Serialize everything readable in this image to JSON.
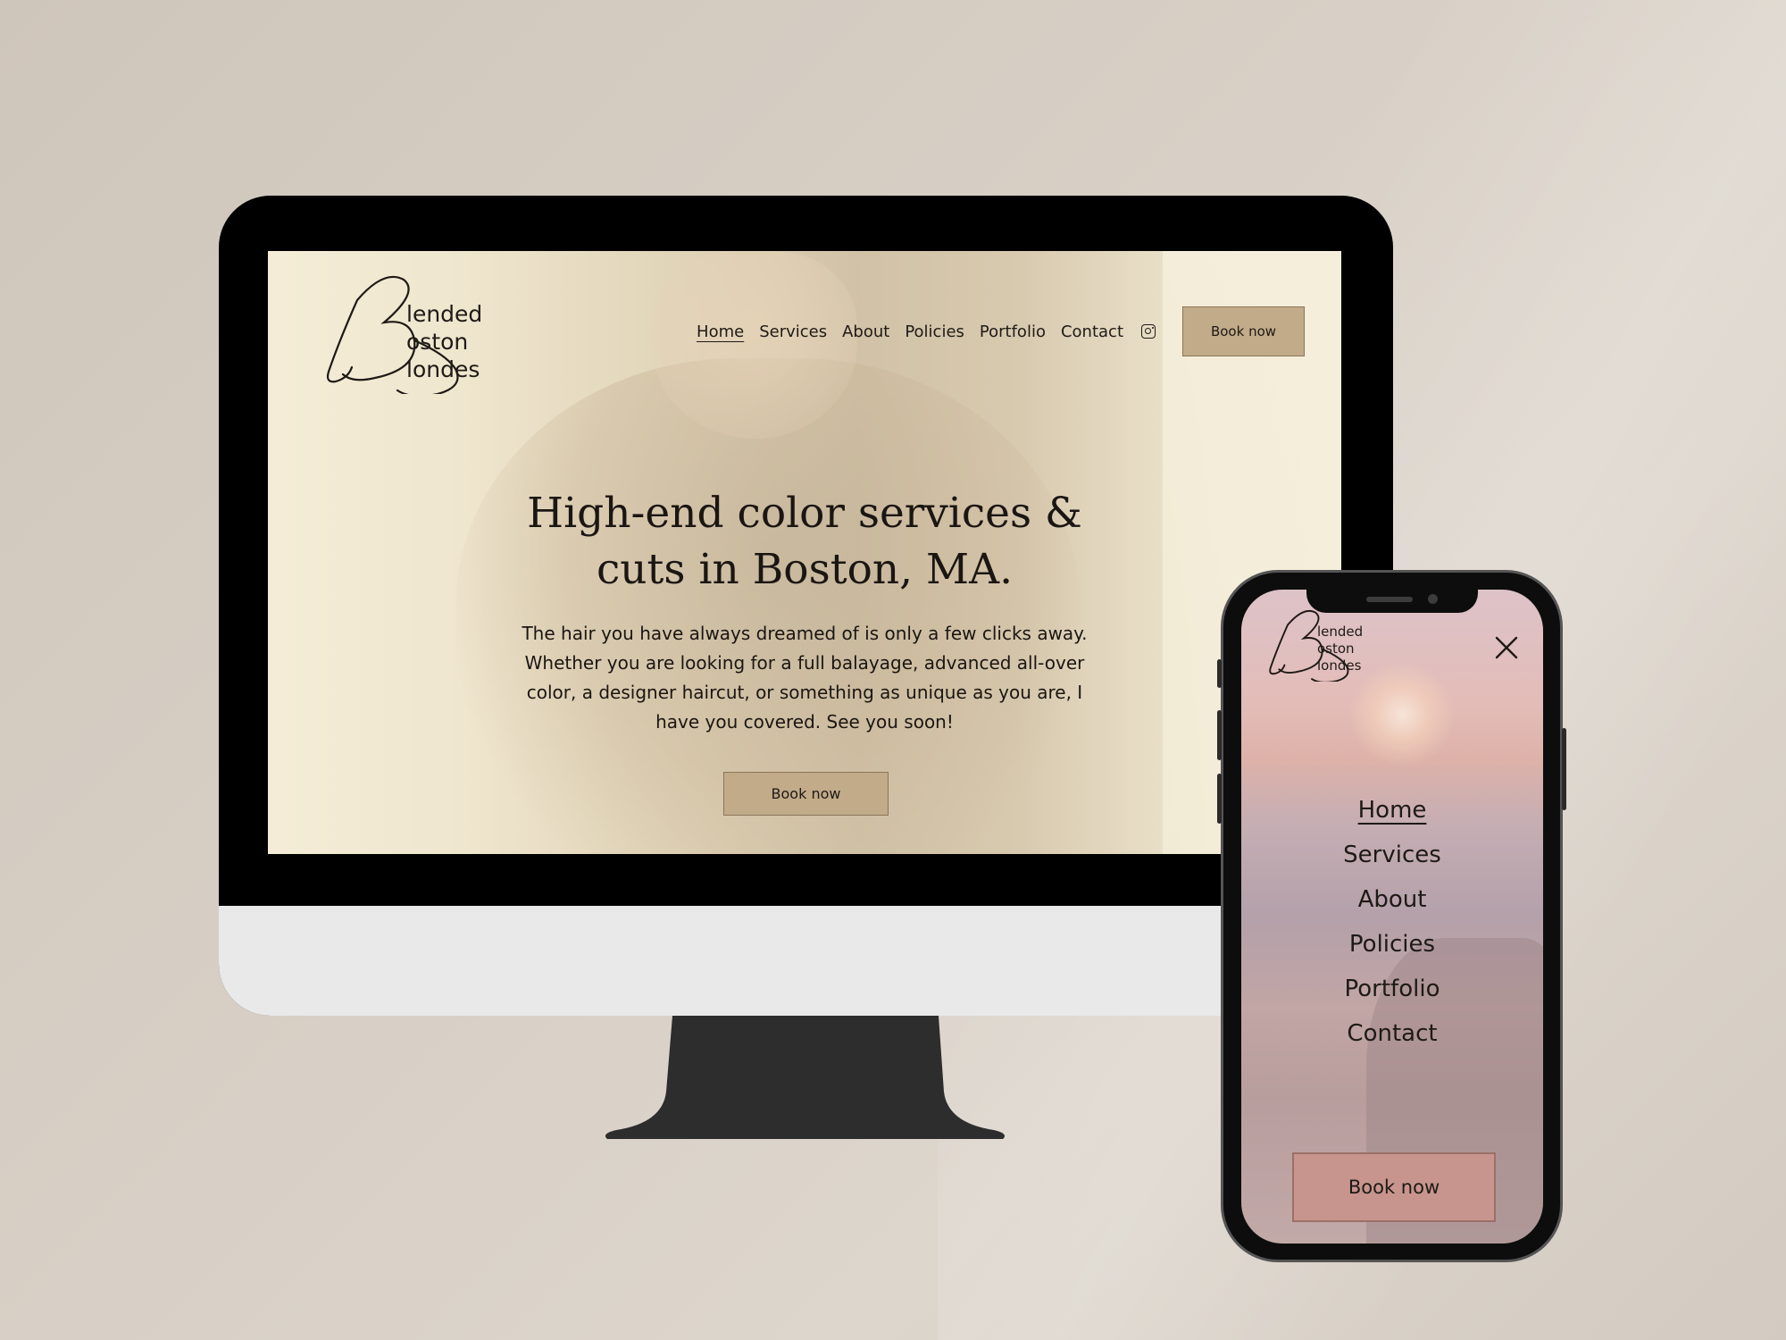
{
  "logo": {
    "initial": "B",
    "line1": "lended",
    "line2": "oston",
    "line3": "londes"
  },
  "desktop": {
    "nav": {
      "items": [
        {
          "label": "Home",
          "active": true
        },
        {
          "label": "Services",
          "active": false
        },
        {
          "label": "About",
          "active": false
        },
        {
          "label": "Policies",
          "active": false
        },
        {
          "label": "Portfolio",
          "active": false
        },
        {
          "label": "Contact",
          "active": false
        }
      ],
      "instagram_icon": "instagram-icon",
      "book_label": "Book now"
    },
    "hero": {
      "title": "High-end color services & cuts in Boston, MA.",
      "text": "The hair you have always dreamed of is only a few clicks away. Whether you are looking for a full balayage, advanced all-over color, a designer haircut, or something as unique as you are, I have you covered. See you soon!",
      "button_label": "Book now"
    }
  },
  "mobile": {
    "close_icon": "close-icon",
    "menu": [
      {
        "label": "Home",
        "active": true
      },
      {
        "label": "Services",
        "active": false
      },
      {
        "label": "About",
        "active": false
      },
      {
        "label": "Policies",
        "active": false
      },
      {
        "label": "Portfolio",
        "active": false
      },
      {
        "label": "Contact",
        "active": false
      }
    ],
    "book_label": "Book now"
  },
  "colors": {
    "desktop_button": "#c2ab89",
    "mobile_button": "#c7958d",
    "text": "#1e1a16",
    "background": "#d6cec4"
  }
}
